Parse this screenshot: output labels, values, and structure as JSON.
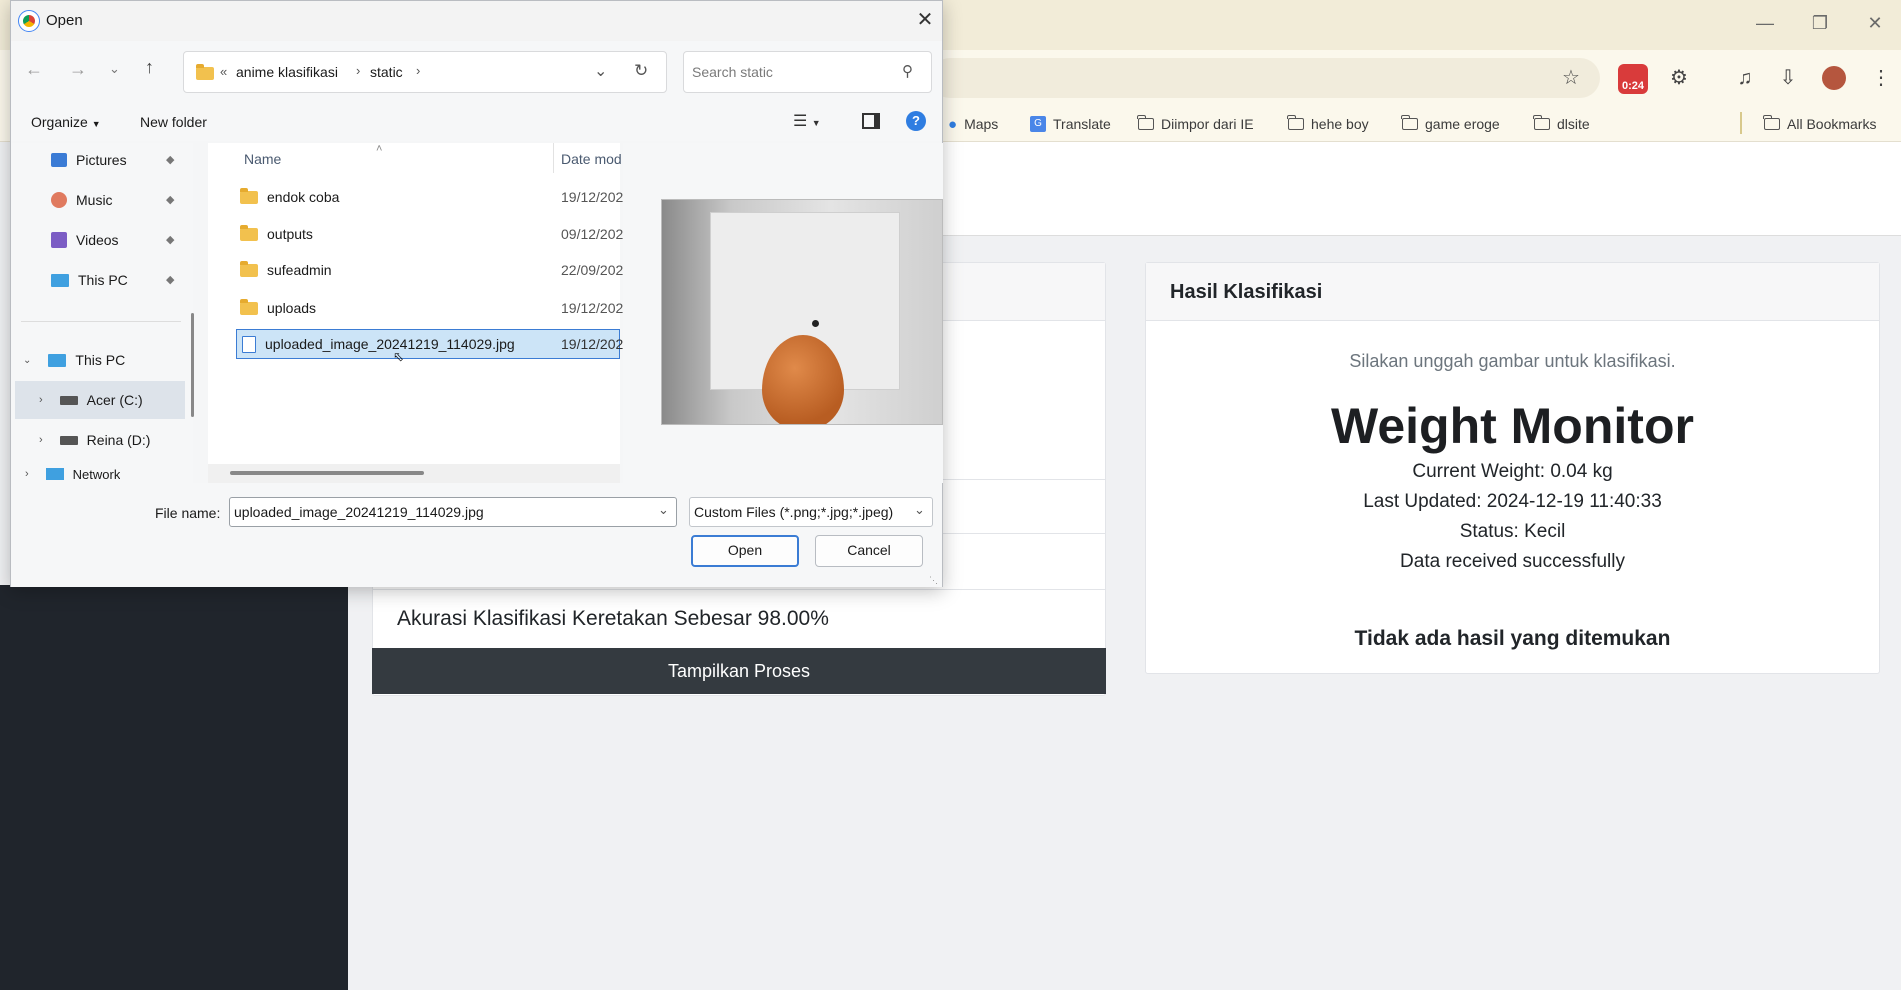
{
  "browser": {
    "bookmarks": [
      {
        "label": "Maps",
        "icon": "maps-pin-icon"
      },
      {
        "label": "Translate",
        "icon": "translate-icon"
      },
      {
        "label": "Diimpor dari IE",
        "icon": "folder-icon"
      },
      {
        "label": "hehe boy",
        "icon": "folder-icon"
      },
      {
        "label": "game eroge",
        "icon": "folder-icon"
      },
      {
        "label": "dlsite",
        "icon": "folder-icon"
      }
    ],
    "all_bookmarks": "All Bookmarks",
    "extension_badge": "0:24"
  },
  "page": {
    "right_card": {
      "title": "Hasil Klasifikasi",
      "upload_hint": "Silakan unggah gambar untuk klasifikasi.",
      "monitor_title": "Weight Monitor",
      "current_weight": "Current Weight: 0.04 kg",
      "last_updated": "Last Updated: 2024-12-19 11:40:33",
      "status": "Status: Kecil",
      "message": "Data received successfully",
      "no_result": "Tidak ada hasil yang ditemukan"
    },
    "left_card": {
      "accuracy": "Akurasi Klasifikasi Keretakan Sebesar 98.00%",
      "show_process_button": "Tampilkan Proses"
    }
  },
  "dialog": {
    "title": "Open",
    "breadcrumb": {
      "overflow": "«",
      "parent": "anime klasifikasi",
      "current": "static"
    },
    "search_placeholder": "Search static",
    "organize": "Organize",
    "new_folder": "New folder",
    "nav_quick": [
      {
        "label": "Pictures",
        "icon": "pictures-icon",
        "color": "#3a7bd5"
      },
      {
        "label": "Music",
        "icon": "music-icon",
        "color": "#e07a5f"
      },
      {
        "label": "Videos",
        "icon": "videos-icon",
        "color": "#7b5cc4"
      },
      {
        "label": "This PC",
        "icon": "pc-icon",
        "color": "#3fa0e0"
      }
    ],
    "nav_tree": {
      "root": "This PC",
      "drives": [
        "Acer (C:)",
        "Reina (D:)"
      ],
      "network": "Network"
    },
    "columns": {
      "name": "Name",
      "date": "Date mod"
    },
    "files": [
      {
        "name": "endok coba",
        "date": "19/12/202",
        "type": "folder"
      },
      {
        "name": "outputs",
        "date": "09/12/202",
        "type": "folder"
      },
      {
        "name": "sufeadmin",
        "date": "22/09/202",
        "type": "folder"
      },
      {
        "name": "uploads",
        "date": "19/12/202",
        "type": "folder"
      },
      {
        "name": "uploaded_image_20241219_114029.jpg",
        "date": "19/12/202",
        "type": "file",
        "selected": true
      }
    ],
    "file_name_label": "File name:",
    "file_name_value": "uploaded_image_20241219_114029.jpg",
    "file_type": "Custom Files (*.png;*.jpg;*.jpeg)",
    "open_button": "Open",
    "cancel_button": "Cancel"
  }
}
